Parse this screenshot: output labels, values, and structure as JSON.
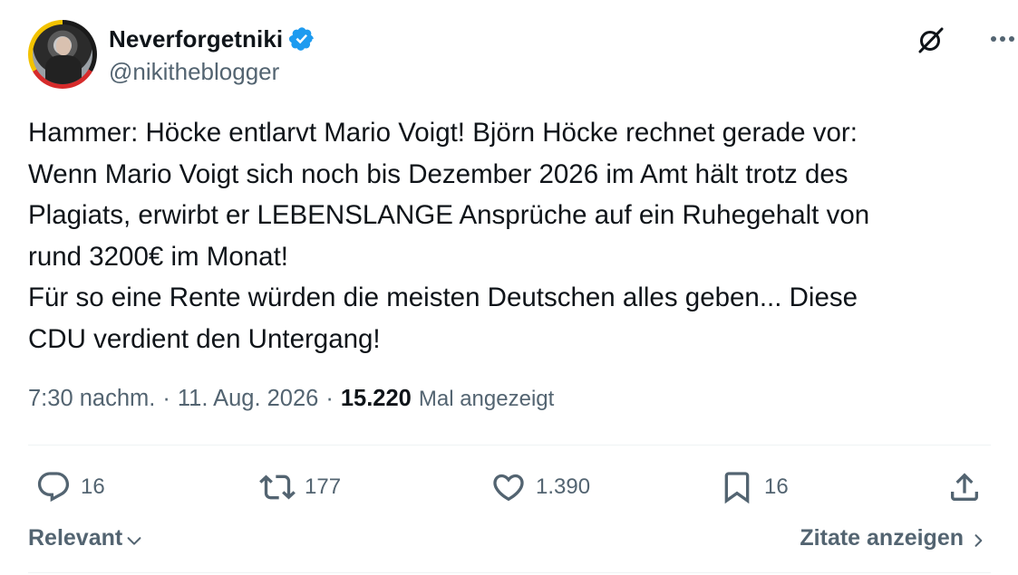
{
  "user": {
    "display_name": "Neverforgetniki",
    "handle": "@nikitheblogger",
    "verified": true
  },
  "tweet": {
    "text": "Hammer: Höcke entlarvt Mario Voigt! Björn Höcke rechnet gerade vor:\nWenn Mario Voigt sich noch bis Dezember 2026 im Amt hält trotz des\nPlagiats, erwirbt er LEBENSLANGE Ansprüche auf ein Ruhegehalt von\nrund 3200€ im Monat!\nFür so eine Rente würden die meisten Deutschen alles geben... Diese\nCDU verdient den Untergang!"
  },
  "meta": {
    "time": "7:30 nachm.",
    "separator": "·",
    "date": "11. Aug. 2026",
    "views_count": "15.220",
    "views_label": "Mal angezeigt"
  },
  "actions": {
    "replies": "16",
    "reposts": "177",
    "likes": "1.390",
    "bookmarks": "16"
  },
  "footer": {
    "sort_label": "Relevant",
    "quotes_label": "Zitate anzeigen"
  },
  "colors": {
    "text": "#0f1419",
    "secondary": "#536471",
    "verified": "#1d9bf0",
    "divider": "#eff3f4"
  },
  "icons": [
    "grok-icon",
    "more-icon",
    "verified-badge-icon",
    "reply-icon",
    "repost-icon",
    "like-icon",
    "bookmark-icon",
    "share-icon",
    "chevron-down-icon",
    "chevron-right-icon"
  ]
}
